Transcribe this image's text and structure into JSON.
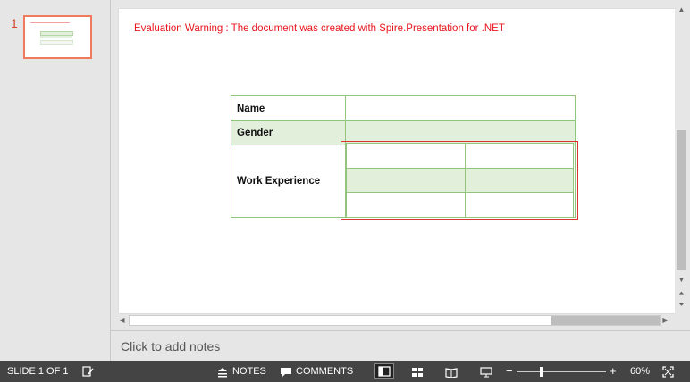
{
  "thumbnail_pane": {
    "slide_number": "1"
  },
  "slide": {
    "warning_text": "Evaluation Warning : The document was created with  Spire.Presentation for .NET",
    "table": {
      "rows": [
        "Name",
        "Gender",
        "Work Experience"
      ],
      "row_fill": [
        "#ffffff",
        "#e2efda",
        "#ffffff"
      ],
      "border_color": "#92c47d"
    },
    "sub_table": {
      "rows": 3,
      "cols": 2,
      "row_fill": [
        "#ffffff",
        "#e2efda",
        "#ffffff"
      ]
    },
    "selection_color": "#dd3333"
  },
  "notes": {
    "placeholder": "Click to add notes"
  },
  "status_bar": {
    "slide_indicator": "SLIDE 1 OF 1",
    "notes_label": "NOTES",
    "comments_label": "COMMENTS",
    "zoom_minus": "−",
    "zoom_plus": "+",
    "zoom_percent": "60%",
    "zoom_level": 0.6
  },
  "icons": {
    "spellcheck": "spellcheck-icon",
    "notes": "notes-icon",
    "comments": "comments-icon",
    "normal_view": "normal-view-icon",
    "slide_sorter": "slide-sorter-icon",
    "reading_view": "reading-view-icon",
    "slideshow": "slideshow-icon",
    "fit": "fit-slide-icon"
  }
}
